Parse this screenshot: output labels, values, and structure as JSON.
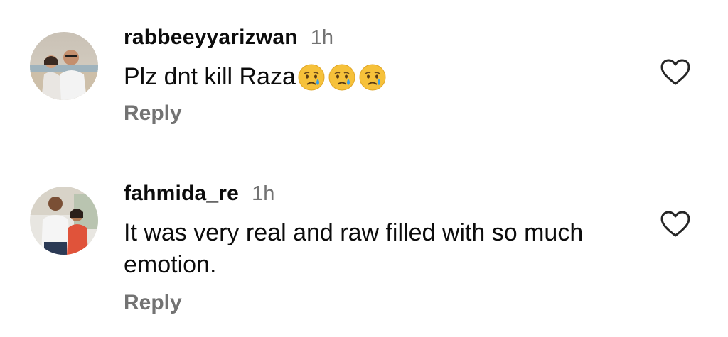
{
  "comments": [
    {
      "username": "rabbeeyyarizwan",
      "time": "1h",
      "text": "Plz dnt kill Raza",
      "emojis": [
        "crying-face-icon",
        "crying-face-icon",
        "crying-face-icon"
      ],
      "reply_label": "Reply"
    },
    {
      "username": "fahmida_re",
      "time": "1h",
      "text": "It was very real and raw filled with so much emotion.",
      "reply_label": "Reply"
    }
  ],
  "colors": {
    "text": "#0c0c0c",
    "muted": "#737373",
    "emoji_face": "#f6c13a",
    "tear": "#3aa0e8"
  }
}
